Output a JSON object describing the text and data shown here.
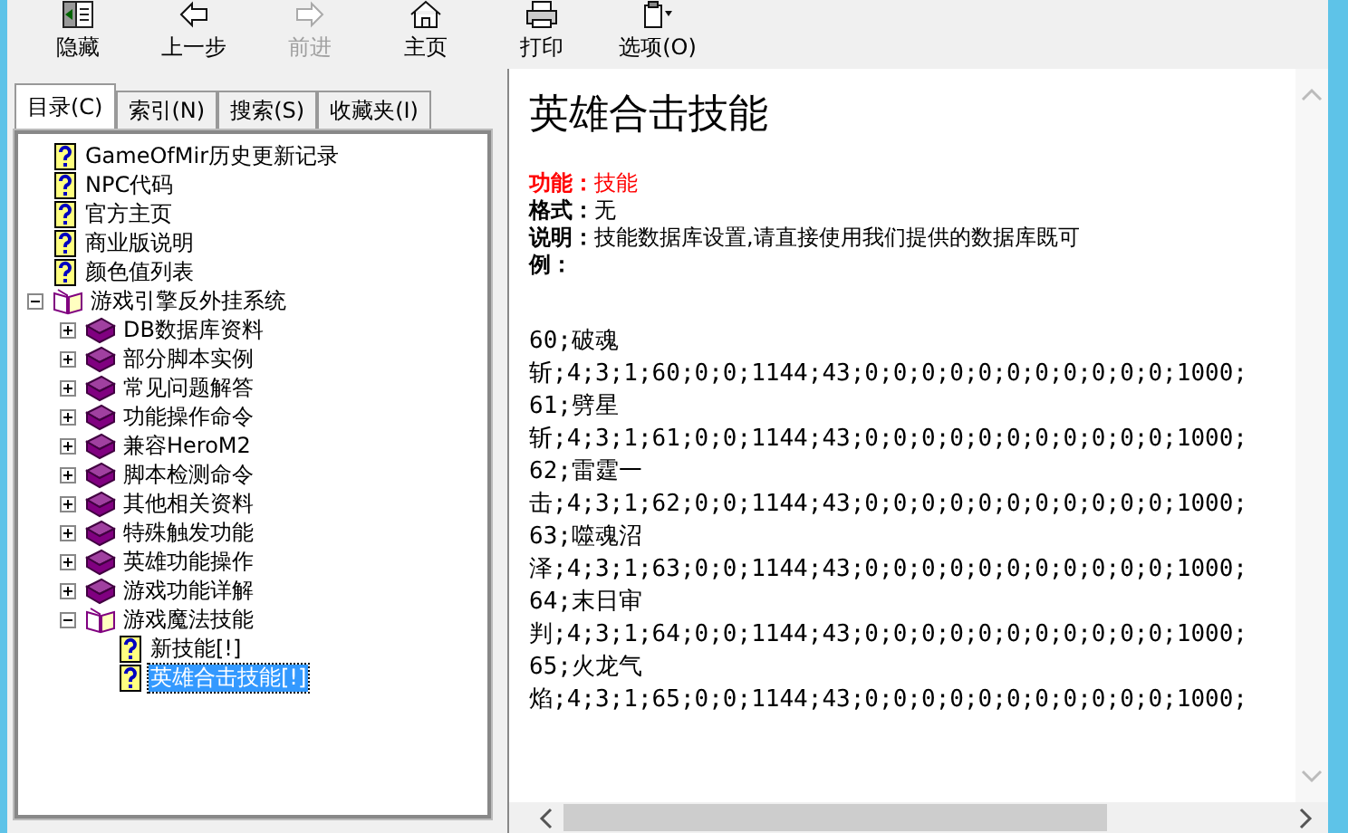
{
  "toolbar": [
    {
      "label": "隐藏",
      "kind": "hide",
      "disabled": false
    },
    {
      "label": "上一步",
      "kind": "back",
      "disabled": false
    },
    {
      "label": "前进",
      "kind": "forward",
      "disabled": true
    },
    {
      "label": "主页",
      "kind": "home",
      "disabled": false
    },
    {
      "label": "打印",
      "kind": "print",
      "disabled": false
    },
    {
      "label": "选项(O)",
      "kind": "options",
      "disabled": false
    }
  ],
  "tabs": [
    {
      "label": "目录(C)",
      "selected": true
    },
    {
      "label": "索引(N)",
      "selected": false
    },
    {
      "label": "搜索(S)",
      "selected": false
    },
    {
      "label": "收藏夹(I)",
      "selected": false
    }
  ],
  "tree": [
    {
      "label": "GameOfMir历史更新记录",
      "kind": "page",
      "selected": false
    },
    {
      "label": "NPC代码",
      "kind": "page",
      "selected": false
    },
    {
      "label": "官方主页",
      "kind": "page",
      "selected": false
    },
    {
      "label": "商业版说明",
      "kind": "page",
      "selected": false
    },
    {
      "label": "颜色值列表",
      "kind": "page",
      "selected": false
    },
    {
      "label": "游戏引擎反外挂系统",
      "kind": "book",
      "expanded": true,
      "selected": false,
      "children": [
        {
          "label": "DB数据库资料",
          "kind": "book",
          "expanded": false,
          "selected": false
        },
        {
          "label": "部分脚本实例",
          "kind": "book",
          "expanded": false,
          "selected": false
        },
        {
          "label": "常见问题解答",
          "kind": "book",
          "expanded": false,
          "selected": false
        },
        {
          "label": "功能操作命令",
          "kind": "book",
          "expanded": false,
          "selected": false
        },
        {
          "label": "兼容HeroM2",
          "kind": "book",
          "expanded": false,
          "selected": false
        },
        {
          "label": "脚本检测命令",
          "kind": "book",
          "expanded": false,
          "selected": false
        },
        {
          "label": "其他相关资料",
          "kind": "book",
          "expanded": false,
          "selected": false
        },
        {
          "label": "特殊触发功能",
          "kind": "book",
          "expanded": false,
          "selected": false
        },
        {
          "label": "英雄功能操作",
          "kind": "book",
          "expanded": false,
          "selected": false
        },
        {
          "label": "游戏功能详解",
          "kind": "book",
          "expanded": false,
          "selected": false
        },
        {
          "label": "游戏魔法技能",
          "kind": "book",
          "expanded": true,
          "selected": false,
          "children": [
            {
              "label": "新技能[!]",
              "kind": "page",
              "selected": false
            },
            {
              "label": "英雄合击技能[!]",
              "kind": "page",
              "selected": true
            }
          ]
        }
      ]
    }
  ],
  "content": {
    "title": "英雄合击技能",
    "fields": [
      {
        "label": "功能：",
        "value": "技能",
        "color": "#ff0000"
      },
      {
        "label": "格式：",
        "value": "无",
        "color": "#000000"
      },
      {
        "label": "说明：",
        "value": "技能数据库设置,请直接使用我们提供的数据库既可",
        "color": "#000000"
      },
      {
        "label": "例：",
        "color": "#000000"
      }
    ],
    "lines": [
      "60;破魂",
      "斩;4;3;1;60;0;0;1144;43;0;0;0;0;0;0;0;0;0;0;0;1000;",
      "61;劈星",
      "斩;4;3;1;61;0;0;1144;43;0;0;0;0;0;0;0;0;0;0;0;1000;",
      "62;雷霆一",
      "击;4;3;1;62;0;0;1144;43;0;0;0;0;0;0;0;0;0;0;0;1000;",
      "63;噬魂沼",
      "泽;4;3;1;63;0;0;1144;43;0;0;0;0;0;0;0;0;0;0;0;1000;",
      "64;末日审",
      "判;4;3;1;64;0;0;1144;43;0;0;0;0;0;0;0;0;0;0;0;1000;",
      "65;火龙气",
      "焰;4;3;1;65;0;0;1144;43;0;0;0;0;0;0;0;0;0;0;0;1000;"
    ]
  }
}
